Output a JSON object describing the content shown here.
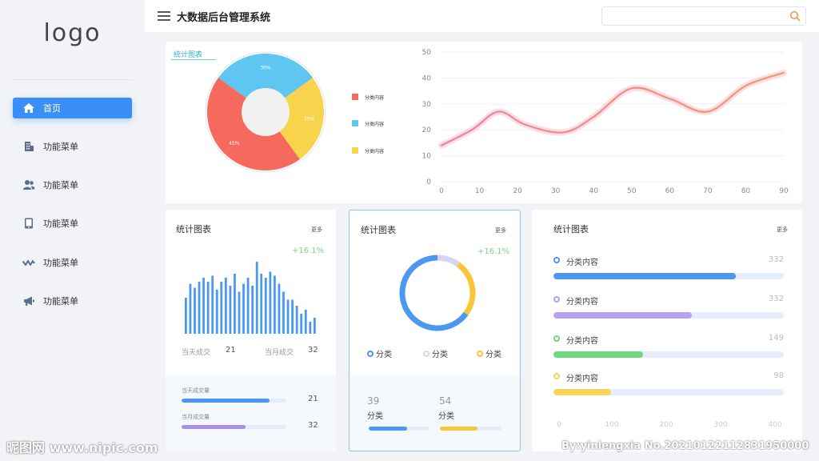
{
  "sidebar": {
    "logo": "logo",
    "items": [
      {
        "label": "首页",
        "icon": "home-icon"
      },
      {
        "label": "功能菜单",
        "icon": "building-icon"
      },
      {
        "label": "功能菜单",
        "icon": "users-icon"
      },
      {
        "label": "功能菜单",
        "icon": "tablet-icon"
      },
      {
        "label": "功能菜单",
        "icon": "wave-icon"
      },
      {
        "label": "功能菜单",
        "icon": "megaphone-icon"
      }
    ]
  },
  "header": {
    "title": "大数据后台管理系统",
    "search_placeholder": ""
  },
  "top_card": {
    "title": "统计图表",
    "pie": {
      "slices": [
        {
          "label": "30%",
          "value": 30,
          "color": "#5ec6f1"
        },
        {
          "label": "25%",
          "value": 25,
          "color": "#f7d44c"
        },
        {
          "label": "45%",
          "value": 45,
          "color": "#f56a5c"
        }
      ],
      "legend": [
        {
          "label": "分类内容",
          "color": "#f56a5c"
        },
        {
          "label": "分类内容",
          "color": "#5ec6f1"
        },
        {
          "label": "分类内容",
          "color": "#f7d44c"
        }
      ]
    },
    "line_chart": {
      "x_ticks": [
        "0",
        "10",
        "20",
        "30",
        "40",
        "50",
        "60",
        "70",
        "80",
        "90"
      ],
      "y_ticks": [
        "0",
        "10",
        "20",
        "30",
        "40",
        "50"
      ]
    }
  },
  "chart_data": [
    {
      "type": "pie",
      "labels": [
        "30%",
        "25%",
        "45%"
      ],
      "values": [
        30,
        25,
        45
      ]
    },
    {
      "type": "line",
      "x": [
        0,
        8,
        15,
        22,
        32,
        40,
        50,
        60,
        70,
        80,
        90
      ],
      "y": [
        14,
        20,
        27,
        22,
        19,
        25,
        36,
        32,
        27,
        37,
        42
      ],
      "xlim": [
        0,
        90
      ],
      "ylim": [
        0,
        50
      ]
    },
    {
      "type": "bar",
      "values": [
        18,
        25,
        23,
        26,
        28,
        26,
        29,
        22,
        26,
        28,
        24,
        30,
        21,
        25,
        28,
        24,
        36,
        30,
        28,
        31,
        29,
        25,
        21,
        17,
        17,
        14,
        10,
        12,
        6,
        8
      ]
    },
    {
      "type": "pie",
      "values": [
        65,
        25,
        10
      ]
    }
  ],
  "card_bar": {
    "title": "统计图表",
    "more": "更多",
    "growth": "+16.1%",
    "stat1_label": "当天成交",
    "stat1_value": "21",
    "stat2_label": "当月成交",
    "stat2_value": "32",
    "foot": [
      {
        "label": "当天成交量",
        "value": "21",
        "progress": 0.84,
        "color": "#4a98f0"
      },
      {
        "label": "当月成交量",
        "value": "32",
        "progress": 0.61,
        "color": "#a98ee8"
      }
    ]
  },
  "card_donut": {
    "title": "统计图表",
    "more": "更多",
    "growth": "+16.1%",
    "legend": [
      {
        "label": "分类",
        "color": "#4a98f0"
      },
      {
        "label": "分类",
        "color": "#d6d4f3"
      },
      {
        "label": "分类",
        "color": "#f7c63a"
      }
    ],
    "foot": [
      {
        "value": "39",
        "label": "分类",
        "progress": 0.63,
        "color": "#4a98f0"
      },
      {
        "value": "54",
        "label": "分类",
        "progress": 0.61,
        "color": "#f7c63a"
      }
    ]
  },
  "card_progress": {
    "title": "统计图表",
    "more": "更多",
    "rows": [
      {
        "label": "分类内容",
        "value": "332",
        "progress": 0.79,
        "color": "#4a98f0"
      },
      {
        "label": "分类内容",
        "value": "332",
        "progress": 0.6,
        "color": "#b7a3ec"
      },
      {
        "label": "分类内容",
        "value": "149",
        "progress": 0.39,
        "color": "#6ed97a"
      },
      {
        "label": "分类内容",
        "value": "98",
        "progress": 0.25,
        "color": "#f9d45d"
      }
    ],
    "x_ticks": [
      "0",
      "100",
      "200",
      "300",
      "400"
    ]
  },
  "watermark": {
    "left": "昵图网 www.nipic.com",
    "right": "By:yinlengxia No.20210122112831950000"
  }
}
